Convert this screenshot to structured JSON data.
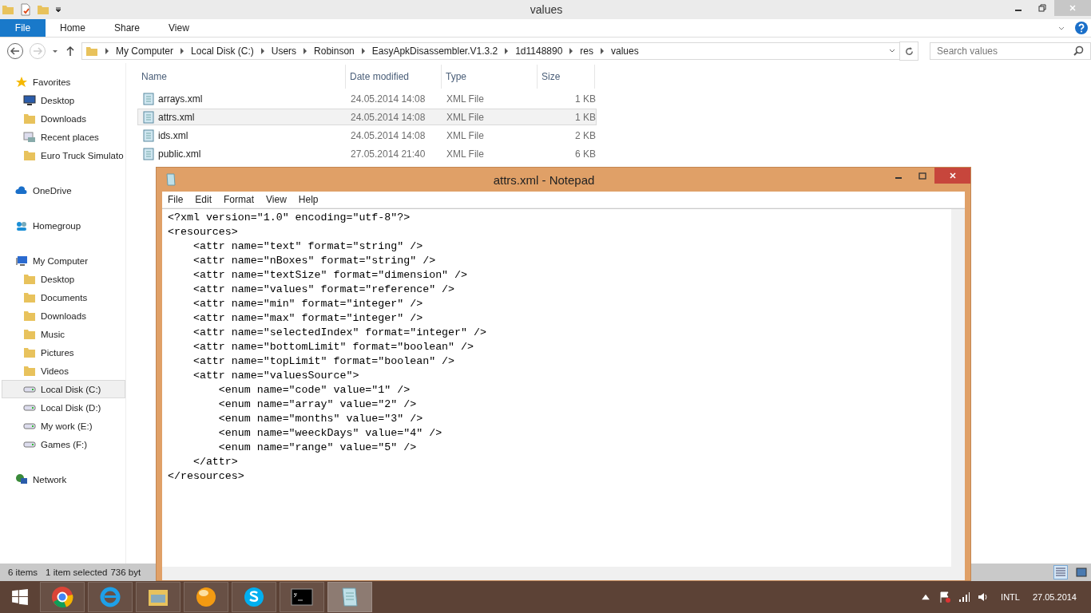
{
  "explorer": {
    "title": "values",
    "ribbon_tabs": [
      {
        "label": "File",
        "kind": "file",
        "selected": false
      },
      {
        "label": "Home",
        "kind": "tab",
        "selected": false
      },
      {
        "label": "Share",
        "kind": "tab",
        "selected": false
      },
      {
        "label": "View",
        "kind": "tab",
        "selected": false
      }
    ],
    "breadcrumb": [
      "My Computer",
      "Local Disk (C:)",
      "Users",
      "Robinson",
      "EasyApkDisassembler.V1.3.2",
      "1d1148890",
      "res",
      "values"
    ],
    "search": {
      "placeholder": "Search values"
    },
    "nav": [
      {
        "label": "Favorites",
        "kind": "star",
        "selected": false,
        "children": [
          {
            "label": "Desktop",
            "kind": "desktop",
            "selected": false
          },
          {
            "label": "Downloads",
            "kind": "folder",
            "selected": false
          },
          {
            "label": "Recent places",
            "kind": "recent",
            "selected": false
          },
          {
            "label": "Euro Truck Simulato",
            "kind": "folder",
            "selected": false
          }
        ]
      },
      {
        "label": "OneDrive",
        "kind": "cloud",
        "selected": false
      },
      {
        "label": "Homegroup",
        "kind": "homegroup",
        "selected": false
      },
      {
        "label": "My Computer",
        "kind": "computer",
        "selected": false,
        "children": [
          {
            "label": "Desktop",
            "kind": "folder",
            "selected": false
          },
          {
            "label": "Documents",
            "kind": "folder",
            "selected": false
          },
          {
            "label": "Downloads",
            "kind": "folder",
            "selected": false
          },
          {
            "label": "Music",
            "kind": "folder",
            "selected": false
          },
          {
            "label": "Pictures",
            "kind": "folder",
            "selected": false
          },
          {
            "label": "Videos",
            "kind": "folder",
            "selected": false
          },
          {
            "label": "Local Disk (C:)",
            "kind": "drive",
            "selected": true
          },
          {
            "label": "Local Disk (D:)",
            "kind": "drive",
            "selected": false
          },
          {
            "label": "My work (E:)",
            "kind": "drive",
            "selected": false
          },
          {
            "label": "Games (F:)",
            "kind": "drive",
            "selected": false
          }
        ]
      },
      {
        "label": "Network",
        "kind": "network",
        "selected": false
      }
    ],
    "columns": [
      "Name",
      "Date modified",
      "Type",
      "Size"
    ],
    "rows": [
      {
        "name": "arrays.xml",
        "date": "24.05.2014 14:08",
        "type": "XML File",
        "size": "1 KB",
        "selected": false
      },
      {
        "name": "attrs.xml",
        "date": "24.05.2014 14:08",
        "type": "XML File",
        "size": "1 KB",
        "selected": true
      },
      {
        "name": "ids.xml",
        "date": "24.05.2014 14:08",
        "type": "XML File",
        "size": "2 KB",
        "selected": false
      },
      {
        "name": "public.xml",
        "date": "27.05.2014 21:40",
        "type": "XML File",
        "size": "6 KB",
        "selected": false
      }
    ],
    "status_bar": [
      "6 items",
      "1 item selected",
      "736 byt"
    ]
  },
  "notepad": {
    "title": "attrs.xml - Notepad",
    "menu": [
      "File",
      "Edit",
      "Format",
      "View",
      "Help"
    ],
    "lines": [
      "<?xml version=\"1.0\" encoding=\"utf-8\"?>",
      "<resources>",
      "    <attr name=\"text\" format=\"string\" />",
      "    <attr name=\"nBoxes\" format=\"string\" />",
      "    <attr name=\"textSize\" format=\"dimension\" />",
      "    <attr name=\"values\" format=\"reference\" />",
      "    <attr name=\"min\" format=\"integer\" />",
      "    <attr name=\"max\" format=\"integer\" />",
      "    <attr name=\"selectedIndex\" format=\"integer\" />",
      "    <attr name=\"bottomLimit\" format=\"boolean\" />",
      "    <attr name=\"topLimit\" format=\"boolean\" />",
      "    <attr name=\"valuesSource\">",
      "        <enum name=\"code\" value=\"1\" />",
      "        <enum name=\"array\" value=\"2\" />",
      "        <enum name=\"months\" value=\"3\" />",
      "        <enum name=\"weeckDays\" value=\"4\" />",
      "        <enum name=\"range\" value=\"5\" />",
      "    </attr>",
      "</resources>"
    ]
  },
  "taskbar": {
    "apps": [
      {
        "kind": "chrome",
        "selected": false
      },
      {
        "kind": "ie",
        "selected": false
      },
      {
        "kind": "explorer",
        "selected": false
      },
      {
        "kind": "ball",
        "selected": false
      },
      {
        "kind": "skype",
        "selected": false
      },
      {
        "kind": "cmd",
        "selected": false
      },
      {
        "kind": "notepad",
        "selected": true
      }
    ],
    "language": "INTL",
    "date": "27.05.2014"
  }
}
